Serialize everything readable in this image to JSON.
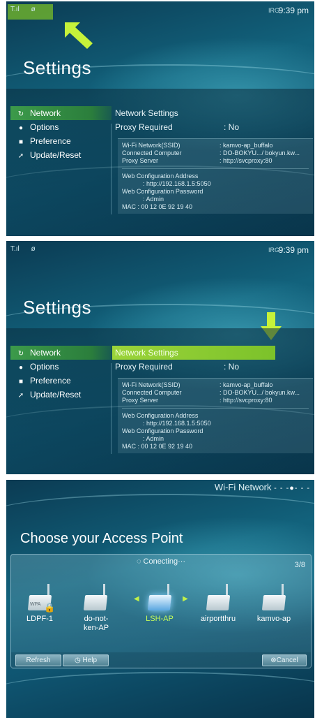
{
  "status_bar": {
    "signal_label": "T.ıl",
    "extra_glyph": "ø",
    "battery_label": "IRG",
    "time": "9:39 pm"
  },
  "settings": {
    "title": "Settings",
    "menu": [
      {
        "label": "Network",
        "icon": "refresh-icon"
      },
      {
        "label": "Options",
        "icon": "wrench-icon"
      },
      {
        "label": "Preference",
        "icon": "preference-icon"
      },
      {
        "label": "Update/Reset",
        "icon": "update-icon"
      }
    ],
    "network_settings_label": "Network Settings",
    "proxy_required_label": "Proxy Required",
    "proxy_required_value": ": No",
    "wifi_network_label": "Wi-Fi Network(SSID)",
    "wifi_network_value": ": kamvo-ap_buffalo",
    "connected_computer_label": "Connected Computer",
    "connected_computer_value": ": DO-BOKYU.../ bokyun.kw...",
    "proxy_server_label": "Proxy Server",
    "proxy_server_value": ": http://svcproxy:80",
    "web_config_address_label": "Web Configuration Address",
    "web_config_address_value": ": http://192.168.1.5:5050",
    "web_config_password_label": "Web Configuration Password",
    "web_config_password_value": ": Admin",
    "mac_label": "MAC : 00 12 0E 92 19 40"
  },
  "access_point": {
    "header": "Wi-Fi Network",
    "header_dots": "- - -●- - -",
    "title": "Choose your Access Point",
    "connecting": "Conecting···",
    "counter": "3/8",
    "wpa_label": "WPA",
    "aps": [
      {
        "name": "LDPF-1",
        "locked": true
      },
      {
        "name": "do-not-ken-AP",
        "locked": false
      },
      {
        "name": "LSH-AP",
        "locked": false,
        "focused": true
      },
      {
        "name": "airportthru",
        "locked": false
      },
      {
        "name": "kamvo-ap",
        "locked": false
      }
    ],
    "refresh_label": "Refresh",
    "help_label": "Help",
    "cancel_label": "Cancel"
  },
  "colors": {
    "accent_green": "#9bd43a",
    "menu_selected": "#3c9a4a",
    "arrow": "#c6f23a"
  }
}
